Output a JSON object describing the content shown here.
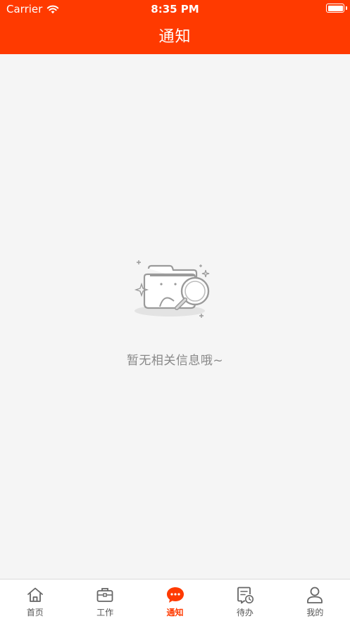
{
  "status_bar": {
    "carrier": "Carrier",
    "time": "8:35 PM"
  },
  "nav": {
    "title": "通知"
  },
  "empty_state": {
    "message": "暂无相关信息哦~",
    "icon": "empty-folder-search-icon"
  },
  "tabbar": {
    "active_index": 2,
    "items": [
      {
        "label": "首页",
        "icon": "home-icon"
      },
      {
        "label": "工作",
        "icon": "briefcase-icon"
      },
      {
        "label": "通知",
        "icon": "chat-bubble-icon"
      },
      {
        "label": "待办",
        "icon": "todo-clock-icon"
      },
      {
        "label": "我的",
        "icon": "user-icon"
      }
    ]
  },
  "colors": {
    "brand": "#ff3a00",
    "background": "#f5f5f5",
    "inactive": "#555555"
  }
}
